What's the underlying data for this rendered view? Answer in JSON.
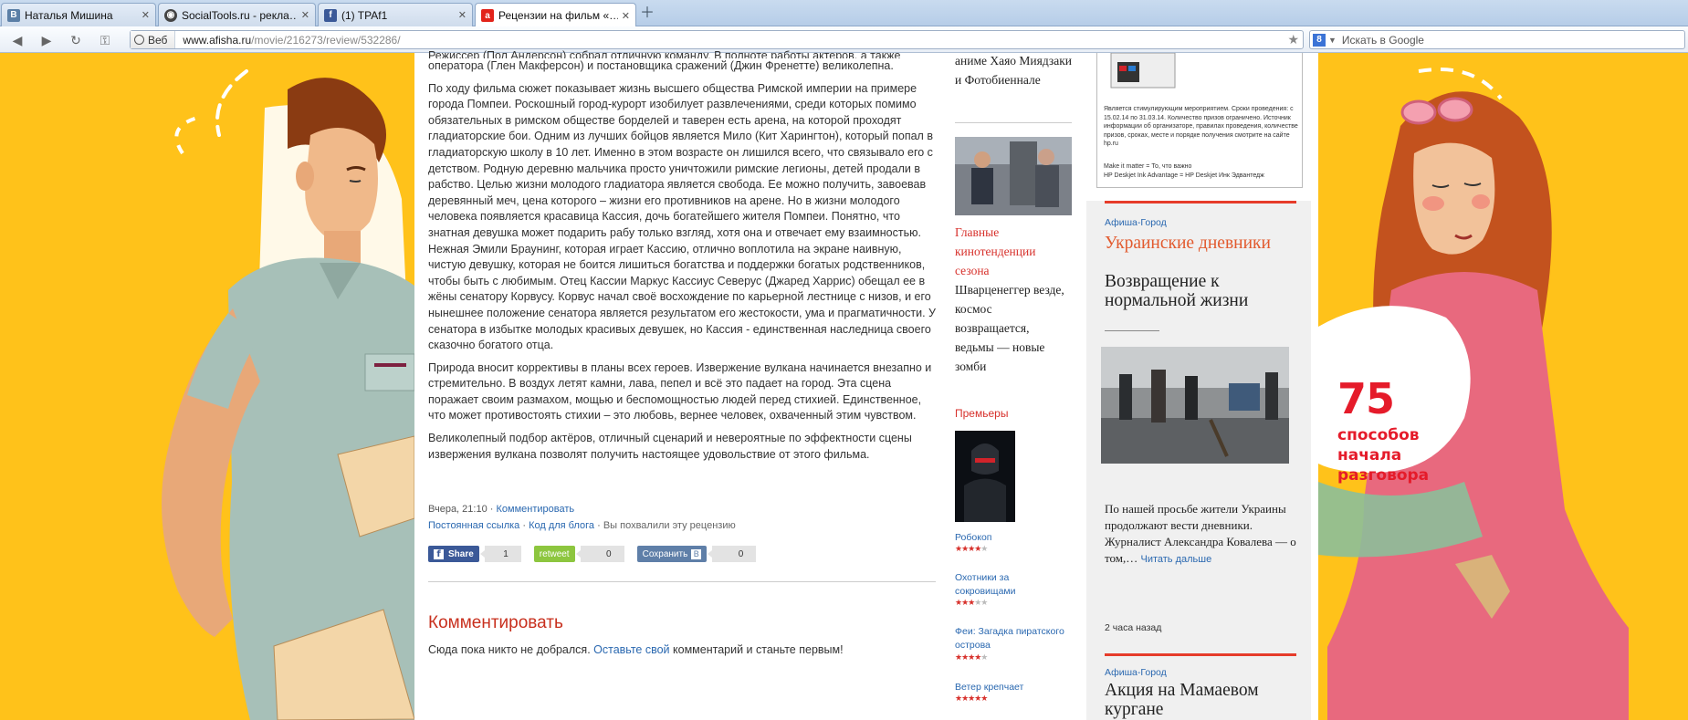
{
  "browser": {
    "tabs": [
      {
        "label": "Наталья Мишина",
        "icon": "B",
        "icon_color": "#5b7fa6"
      },
      {
        "label": "SocialTools.ru - рекла…",
        "icon": "◉",
        "icon_color": "#444444"
      },
      {
        "label": "(1) TPAf1",
        "icon": "f",
        "icon_color": "#3b5998"
      },
      {
        "label": "Рецензии на фильм «…",
        "icon": "a",
        "icon_color": "#e2231a"
      }
    ],
    "web_button": "Веб",
    "url_host": "www.afisha.ru",
    "url_path": "/movie/216273/review/532286/",
    "search_placeholder": "Искать в Google"
  },
  "article": {
    "top_fragment": "Режиссер (Пол Андерсон) собрал отличную команду. В полноте работы актеров, а также",
    "p1": "оператора (Глен Макферсон) и постановщика сражений (Джин Френетте) великолепна.",
    "p2": "По ходу фильма сюжет показывает жизнь высшего общества Римской империи на примере города Помпеи. Роскошный город-курорт изобилует развлечениями, среди которых помимо обязательных в римском обществе борделей и таверен есть арена, на которой проходят гладиаторские бои. Одним из лучших бойцов является Мило (Кит Харингтон), который попал в гладиаторскую школу в 10 лет. Именно в этом возрасте он лишился всего, что связывало его с детством. Родную деревню мальчика просто уничтожили римские легионы, детей продали в рабство. Целью жизни молодого гладиатора является свобода. Ее можно получить, завоевав деревянный меч, цена которого – жизни его противников на арене. Но в жизни молодого человека появляется красавица Кассия, дочь богатейшего жителя Помпеи. Понятно, что знатная девушка может подарить рабу только взгляд, хотя она и отвечает ему взаимностью. Нежная Эмили Браунинг, которая играет Кассию, отлично воплотила на экране наивную, чистую девушку, которая не боится лишиться богатства и поддержки богатых родственников, чтобы быть с любимым. Отец Кассии Маркус Кассиус Северус (Джаред Харрис) обещал ее в жёны сенатору Корвусу. Корвус начал своё восхождение по карьерной лестнице с низов, и его нынешнее положение сенатора является результатом его жестокости, ума и прагматичности. У сенатора в избытке молодых красивых девушек, но Кассия - единственная наследница своего сказочно богатого отца.",
    "p3": "Природа вносит коррективы в планы всех героев. Извержение вулкана начинается внезапно и стремительно. В воздух летят камни, лава, пепел и всё это падает на город. Эта сцена поражает своим размахом, мощью и беспомощностью людей перед стихией. Единственное, что может противостоять стихии – это любовь, вернее человек, охваченный этим чувством.",
    "p4": "Великолепный подбор актёров, отличный сценарий и невероятные по эффектности сцены извержения вулкана позволят получить настоящее удовольствие от этого фильма.",
    "meta_time": "Вчера, 21:10",
    "meta_sep": " · ",
    "comment_link": "Комментировать",
    "permalink": "Постоянная ссылка",
    "blog_code": "Код для блога",
    "praised": "Вы похвалили эту рецензию",
    "share": {
      "fb_label": "Share",
      "fb_count": "1",
      "rt_label": "retweet",
      "rt_count": "0",
      "vk_label": "Сохранить",
      "vk_count": "0"
    },
    "comments_title": "Комментировать",
    "comments_empty_1": "Сюда пока никто не добрался. ",
    "comments_empty_link": "Оставьте свой",
    "comments_empty_2": " комментарий и станьте первым!"
  },
  "middle": {
    "top_text": "аниме Хаяо Миядзаки и Фотобиеннале",
    "trends_title": "Главные кинотенденции сезона",
    "trends_text": "Шварценеггер везде, космос возвращается, ведьмы — новые зомби",
    "premieres_title": "Премьеры",
    "premieres": [
      {
        "title": "Робокоп",
        "stars": 4
      },
      {
        "title": "Охотники за сокровищами",
        "stars": 3
      },
      {
        "title": "Феи: Загадка пиратского острова",
        "stars": 4
      },
      {
        "title": "Ветер крепчает",
        "stars": 5
      }
    ]
  },
  "right": {
    "ad_text_1": "Является стимулирующим мероприятием. Сроки проведения: с 15.02.14 по 31.03.14. Количество призов ограничено. Источник информации об организаторе, правилах проведения, количестве призов, сроках, месте и порядке получения смотрите на сайте hp.ru",
    "ad_text_2": "Make it matter = То, что важно\nHP Deskjet Ink Advantage = HP Deskjet Инк Эдвантедж",
    "section_1": "Афиша-Город",
    "headline_red": "Украинские дневники",
    "headline_black": "Возвращение к нормальной жизни",
    "lead": "По нашей просьбе жители Украины продолжают вести дневники. Журналист Александра Ковалева — о том,…",
    "read_more": "Читать дальше",
    "time_ago": "2 часа назад",
    "section_2": "Афиша-Город",
    "headline_2": "Акция на Мамаевом кургане"
  },
  "promo": {
    "number": "75",
    "text": "способов\nначала\nразговора"
  }
}
